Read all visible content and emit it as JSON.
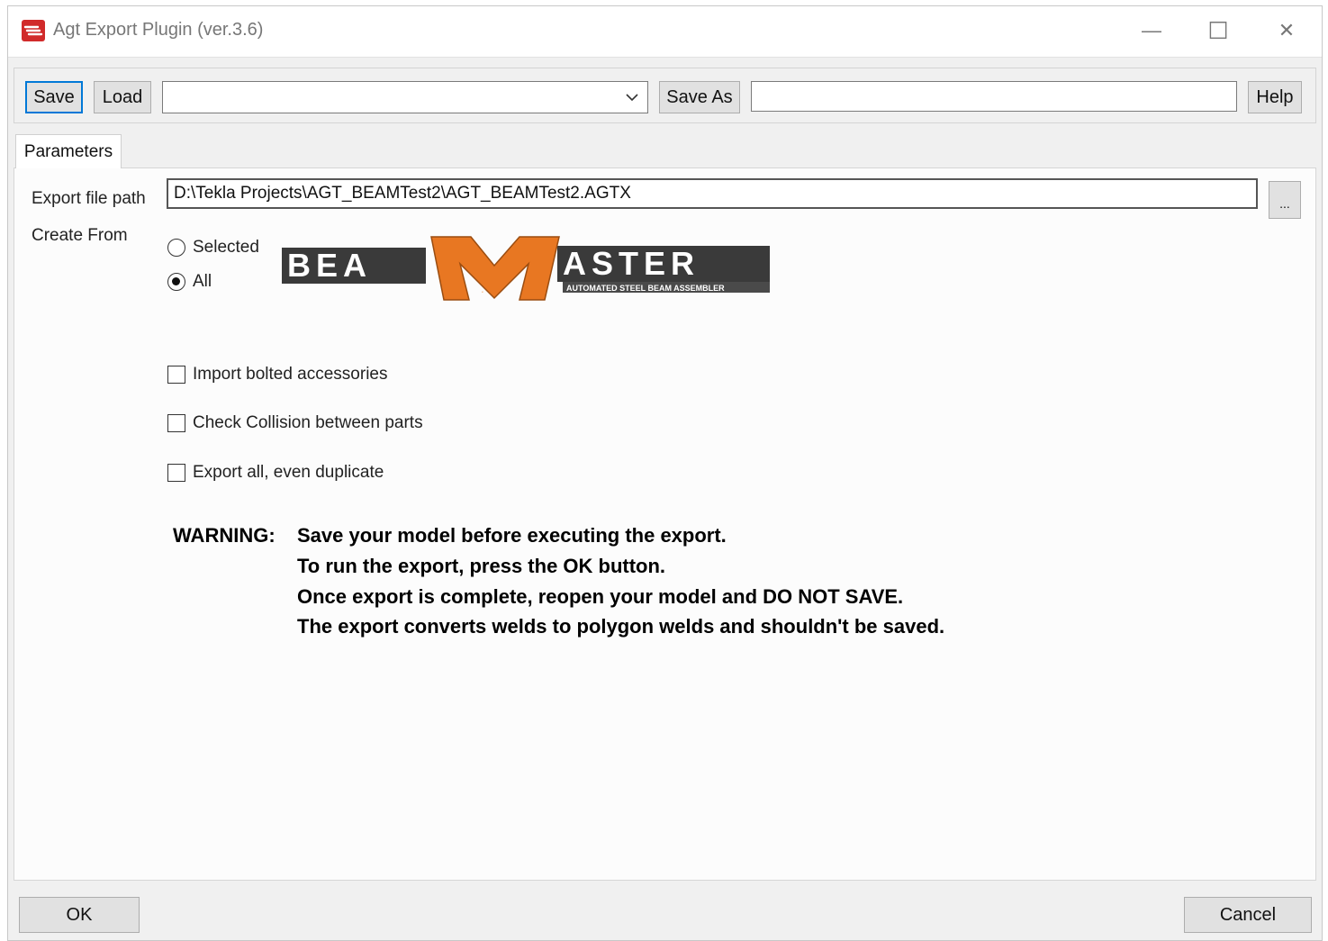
{
  "window": {
    "title": "Agt Export Plugin (ver.3.6)",
    "minimize_glyph": "—",
    "maximize_glyph": "☐",
    "close_glyph": "✕"
  },
  "toolbar": {
    "save_label": "Save",
    "load_label": "Load",
    "preset_value": "",
    "save_as_label": "Save As",
    "save_as_value": "",
    "help_label": "Help"
  },
  "tabs": [
    {
      "label": "Parameters"
    }
  ],
  "parameters": {
    "export_path_label": "Export file path",
    "export_path_value": "D:\\Tekla Projects\\AGT_BEAMTest2\\AGT_BEAMTest2.AGTX",
    "browse_label": "...",
    "create_from_label": "Create From",
    "create_from_options": [
      {
        "label": "Selected",
        "checked": false
      },
      {
        "label": "All",
        "checked": true
      }
    ],
    "checkboxes": [
      {
        "label": "Import bolted accessories",
        "checked": false
      },
      {
        "label": "Check Collision between parts",
        "checked": false
      },
      {
        "label": "Export all, even duplicate",
        "checked": false
      }
    ],
    "warning": {
      "prefix": "WARNING:",
      "lines": [
        "Save your model before executing the export.",
        "To run the export, press the OK button.",
        "Once export is complete, reopen your model and DO NOT SAVE.",
        "The export converts welds to polygon welds and shouldn't be saved."
      ]
    }
  },
  "logo": {
    "left_text": "BEA",
    "center_letter": "M",
    "right_text": "ASTER",
    "tagline": "AUTOMATED STEEL BEAM ASSEMBLER"
  },
  "footer": {
    "ok_label": "OK",
    "cancel_label": "Cancel"
  },
  "colors": {
    "accent": "#0078d7",
    "logo_orange": "#e87722",
    "window_bg": "#f0f0f0"
  }
}
